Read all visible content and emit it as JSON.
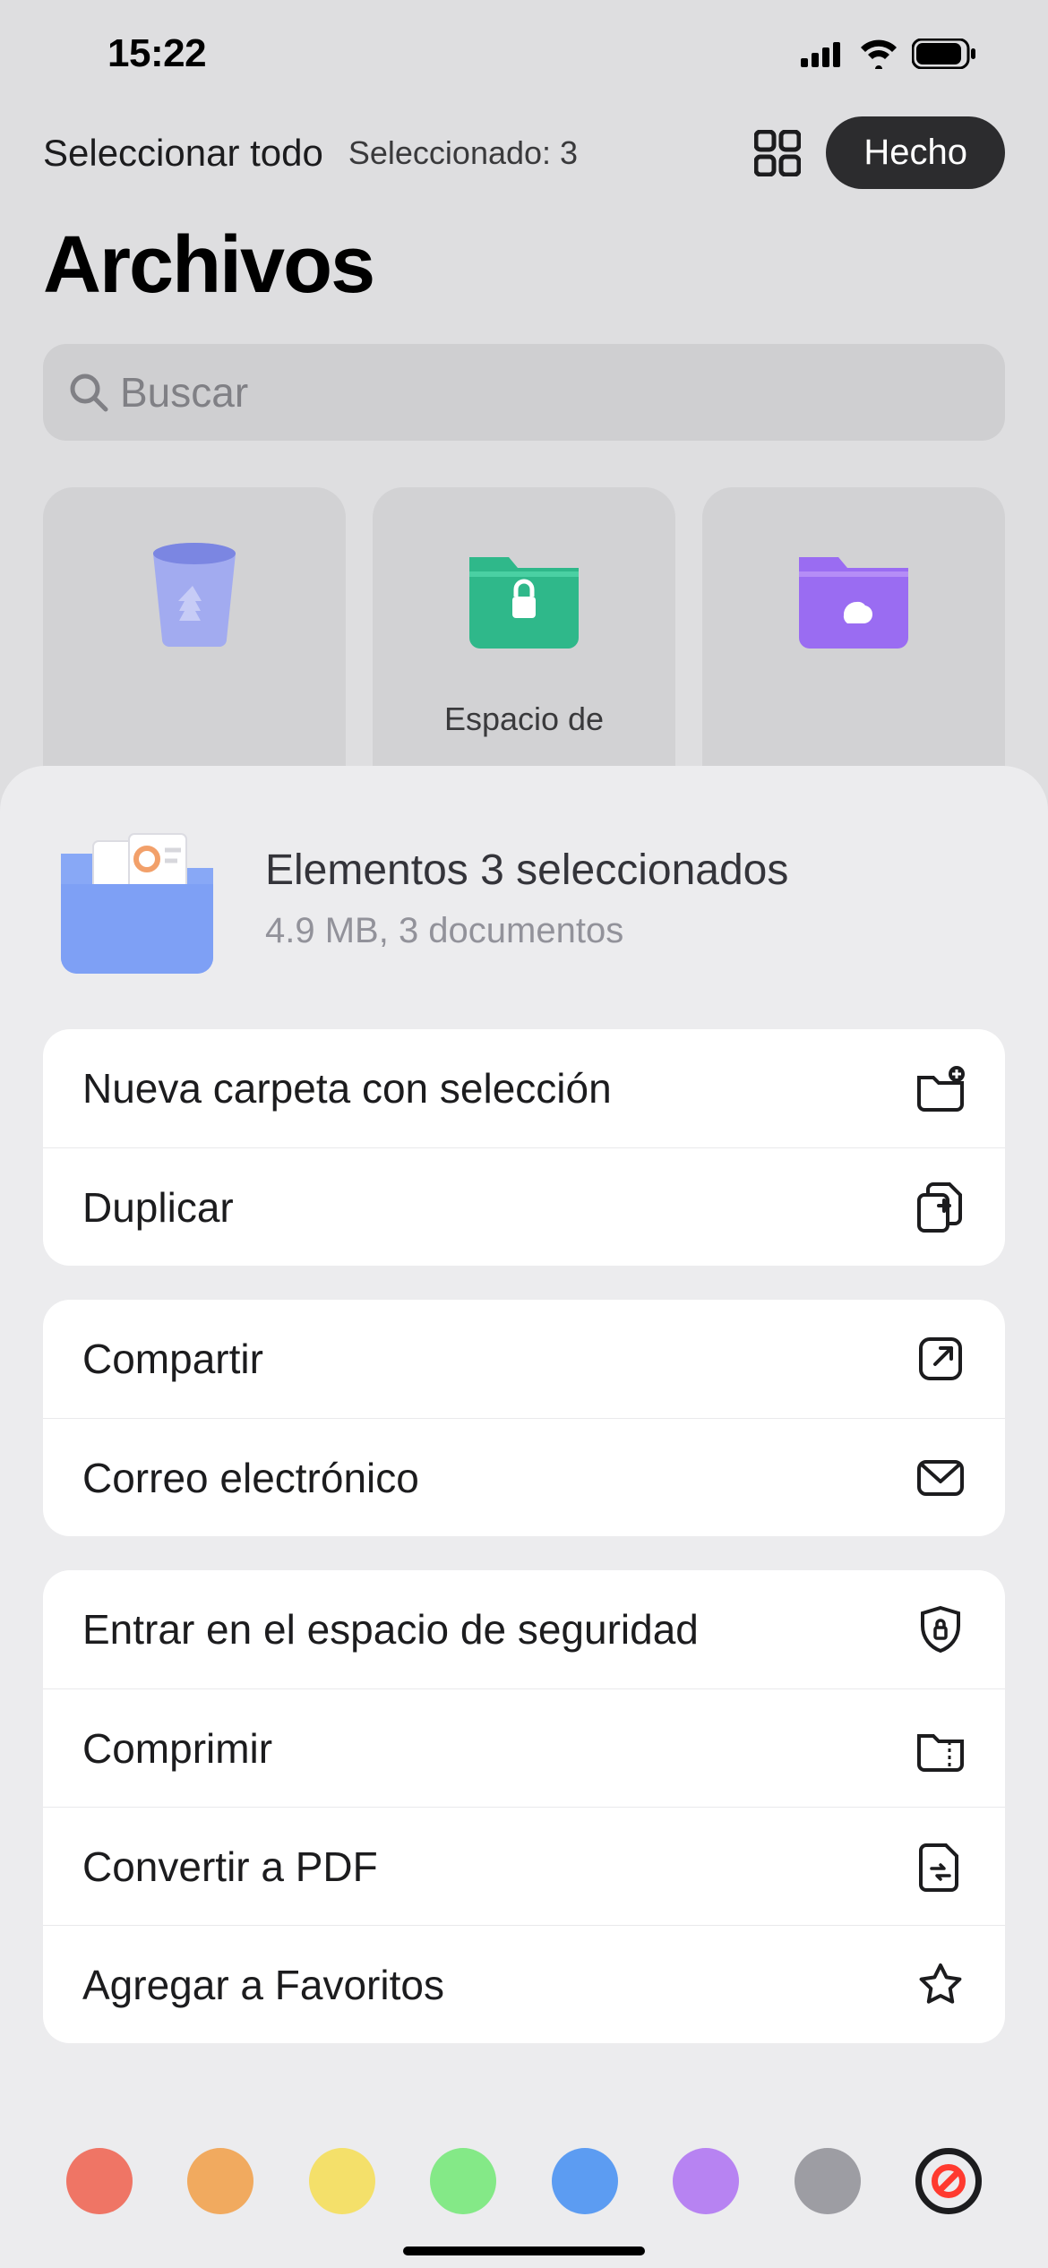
{
  "statusBar": {
    "time": "15:22"
  },
  "nav": {
    "selectAll": "Seleccionar todo",
    "selectedCount": "Seleccionado: 3",
    "done": "Hecho"
  },
  "pageTitle": "Archivos",
  "search": {
    "placeholder": "Buscar"
  },
  "folders": [
    {
      "id": "trash",
      "label": ""
    },
    {
      "id": "secure",
      "label": "Espacio de"
    },
    {
      "id": "cloud",
      "label": ""
    }
  ],
  "sheet": {
    "title": "Elementos 3 seleccionados",
    "subtitle": "4.9 MB, 3 documentos",
    "groups": [
      [
        {
          "id": "new-folder",
          "label": "Nueva carpeta con selección",
          "icon": "folder-plus"
        },
        {
          "id": "duplicate",
          "label": "Duplicar",
          "icon": "doc-plus"
        }
      ],
      [
        {
          "id": "share",
          "label": "Compartir",
          "icon": "share"
        },
        {
          "id": "email",
          "label": "Correo electrónico",
          "icon": "mail"
        }
      ],
      [
        {
          "id": "secure-space",
          "label": "Entrar en el espacio de seguridad",
          "icon": "shield-lock"
        },
        {
          "id": "compress",
          "label": "Comprimir",
          "icon": "zip"
        },
        {
          "id": "to-pdf",
          "label": "Convertir a PDF",
          "icon": "convert"
        },
        {
          "id": "favorite",
          "label": "Agregar a Favoritos",
          "icon": "star"
        }
      ]
    ]
  },
  "colors": [
    "#ef7565",
    "#f1aa5f",
    "#f4e06a",
    "#84e987",
    "#5c9cf2",
    "#b783f2",
    "#9d9da3"
  ]
}
